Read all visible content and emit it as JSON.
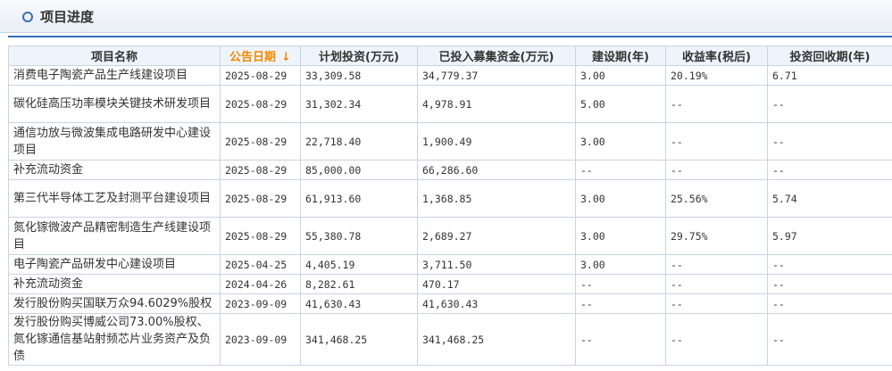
{
  "panel": {
    "title": "项目进度"
  },
  "table": {
    "headers": [
      "项目名称",
      "公告日期",
      "计划投资(万元)",
      "已投入募集资金(万元)",
      "建设期(年)",
      "收益率(税后)",
      "投资回收期(年)"
    ],
    "sort_arrow": "↓",
    "rows": [
      [
        "消费电子陶瓷产品生产线建设项目",
        "2025-08-29",
        "33,309.58",
        "34,779.37",
        "3.00",
        "20.19%",
        "6.71"
      ],
      [
        "碳化硅高压功率模块关键技术研发项目",
        "2025-08-29",
        "31,302.34",
        "4,978.91",
        "5.00",
        "--",
        "--"
      ],
      [
        "通信功放与微波集成电路研发中心建设项目",
        "2025-08-29",
        "22,718.40",
        "1,900.49",
        "3.00",
        "--",
        "--"
      ],
      [
        "补充流动资金",
        "2025-08-29",
        "85,000.00",
        "66,286.60",
        "--",
        "--",
        "--"
      ],
      [
        "第三代半导体工艺及封测平台建设项目",
        "2025-08-29",
        "61,913.60",
        "1,368.85",
        "3.00",
        "25.56%",
        "5.74"
      ],
      [
        "氮化镓微波产品精密制造生产线建设项目",
        "2025-08-29",
        "55,380.78",
        "2,689.27",
        "3.00",
        "29.75%",
        "5.97"
      ],
      [
        "电子陶瓷产品研发中心建设项目",
        "2025-04-25",
        "4,405.19",
        "3,711.50",
        "3.00",
        "--",
        "--"
      ],
      [
        "补充流动资金",
        "2024-04-26",
        "8,282.61",
        "470.17",
        "--",
        "--",
        "--"
      ],
      [
        "发行股份购买国联万众94.6029%股权",
        "2023-09-09",
        "41,630.43",
        "41,630.43",
        "--",
        "--",
        "--"
      ],
      [
        "发行股份购买博威公司73.00%股权、氮化镓通信基站射频芯片业务资产及负债",
        "2023-09-09",
        "341,468.25",
        "341,468.25",
        "--",
        "--",
        "--"
      ]
    ]
  }
}
